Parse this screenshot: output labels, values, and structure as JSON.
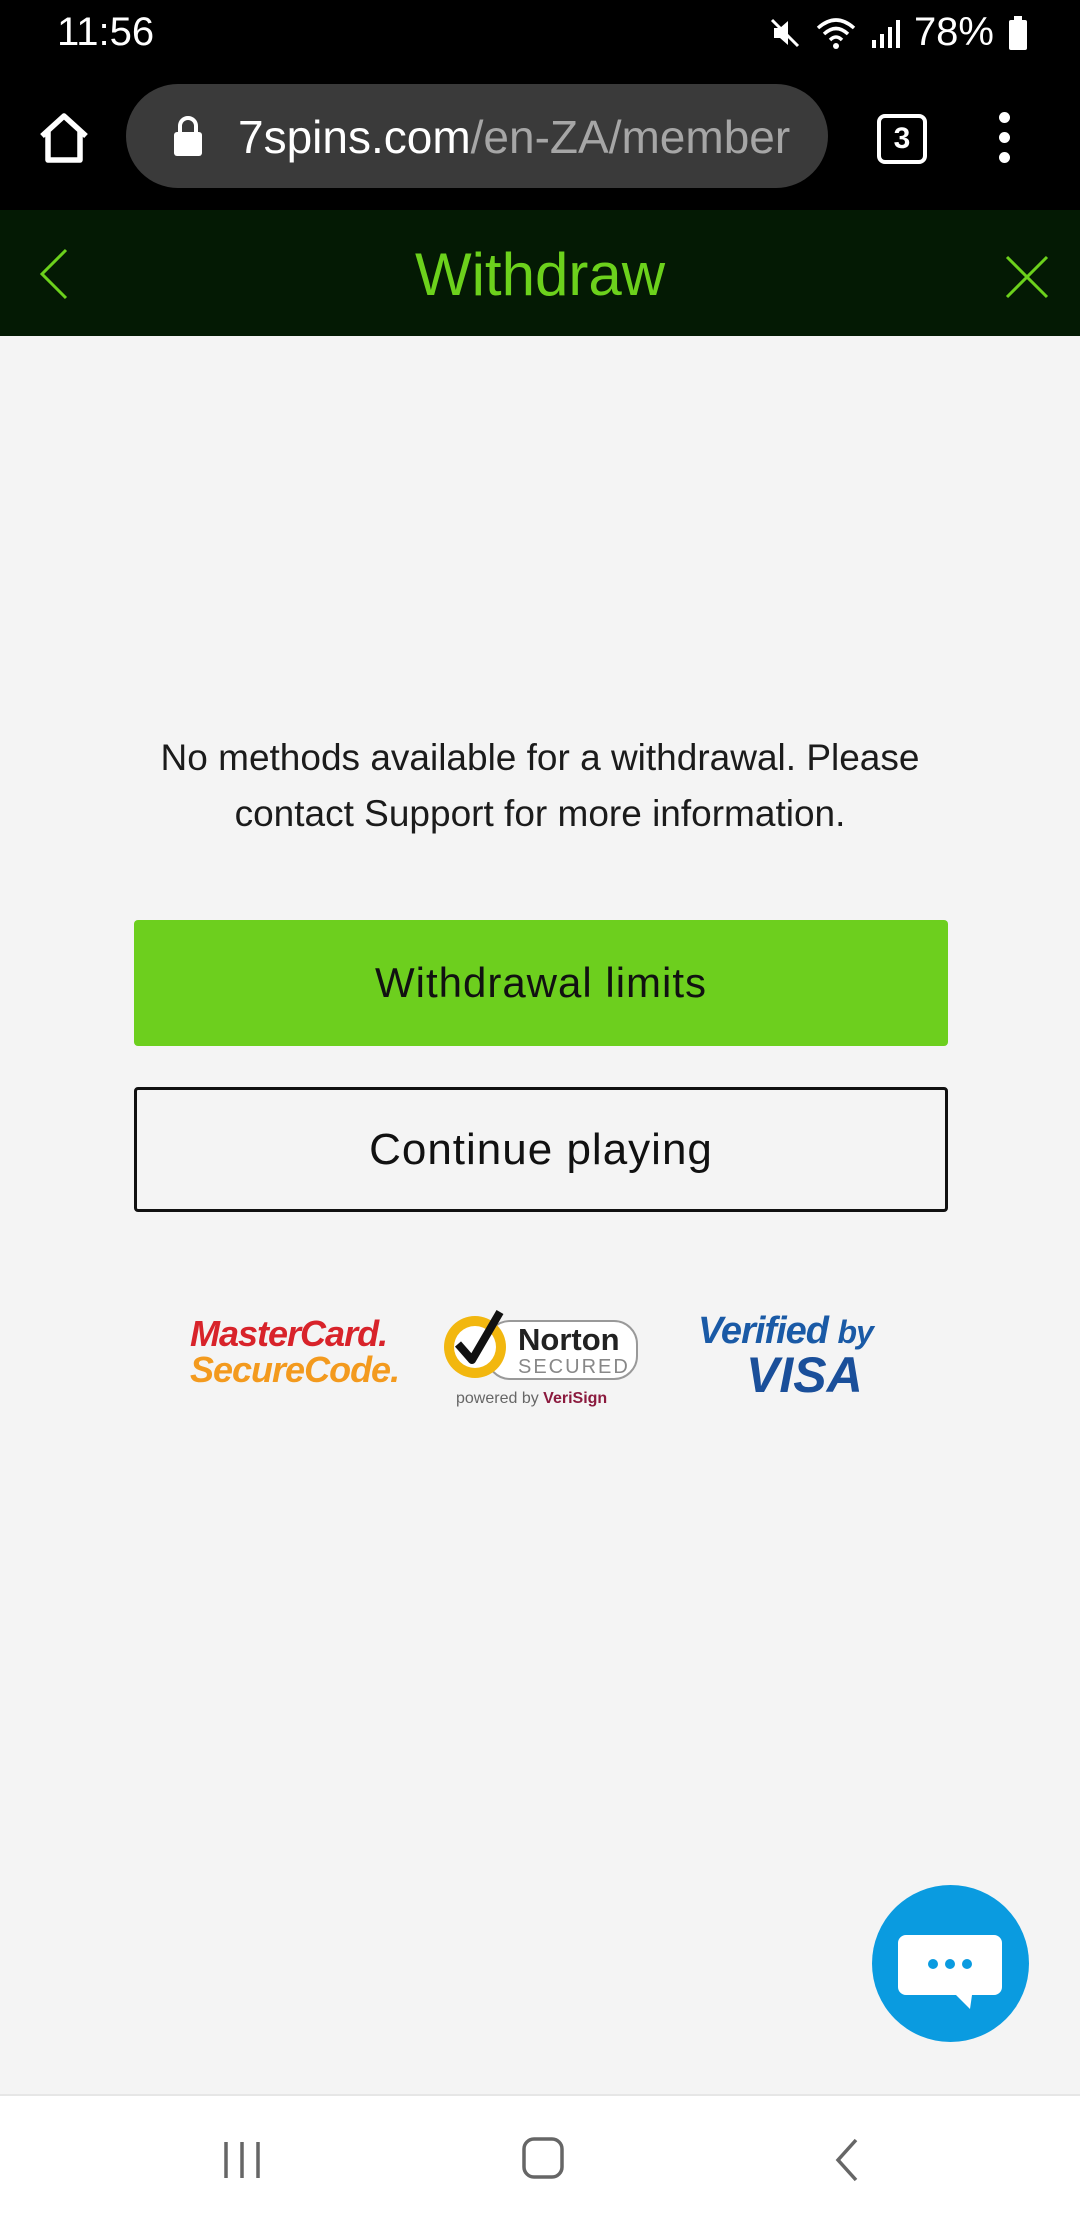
{
  "status_bar": {
    "time": "11:56",
    "battery": "78%"
  },
  "browser": {
    "url_host": "7spins.com",
    "url_path": "/en-ZA/member",
    "tab_count": "3"
  },
  "header": {
    "title": "Withdraw"
  },
  "main": {
    "message": "No methods available for a withdrawal. Please contact Support for more information.",
    "primary_button": "Withdrawal limits",
    "secondary_button": "Continue playing"
  },
  "trust_logos": {
    "mastercard_line1": "MasterCard.",
    "mastercard_line2": "SecureCode.",
    "norton_name": "Norton",
    "norton_secured": "SECURED",
    "norton_powered": "powered by ",
    "norton_verisign": "VeriSign",
    "visa_verified": "Verified",
    "visa_by": "by",
    "visa_name": "VISA"
  },
  "colors": {
    "accent_green": "#6dcf1e",
    "header_bg": "#041a04",
    "chat_blue": "#0a9be0"
  },
  "icons": {
    "status": [
      "mute-icon",
      "wifi-icon",
      "signal-icon",
      "battery-icon"
    ],
    "browser": [
      "home-icon",
      "lock-icon",
      "tabs-icon",
      "more-vert-icon"
    ],
    "header": [
      "back-chevron-icon",
      "close-icon"
    ],
    "chat": "chat-bubble-icon",
    "nav": [
      "recent-apps-icon",
      "home-nav-icon",
      "back-nav-icon"
    ]
  }
}
